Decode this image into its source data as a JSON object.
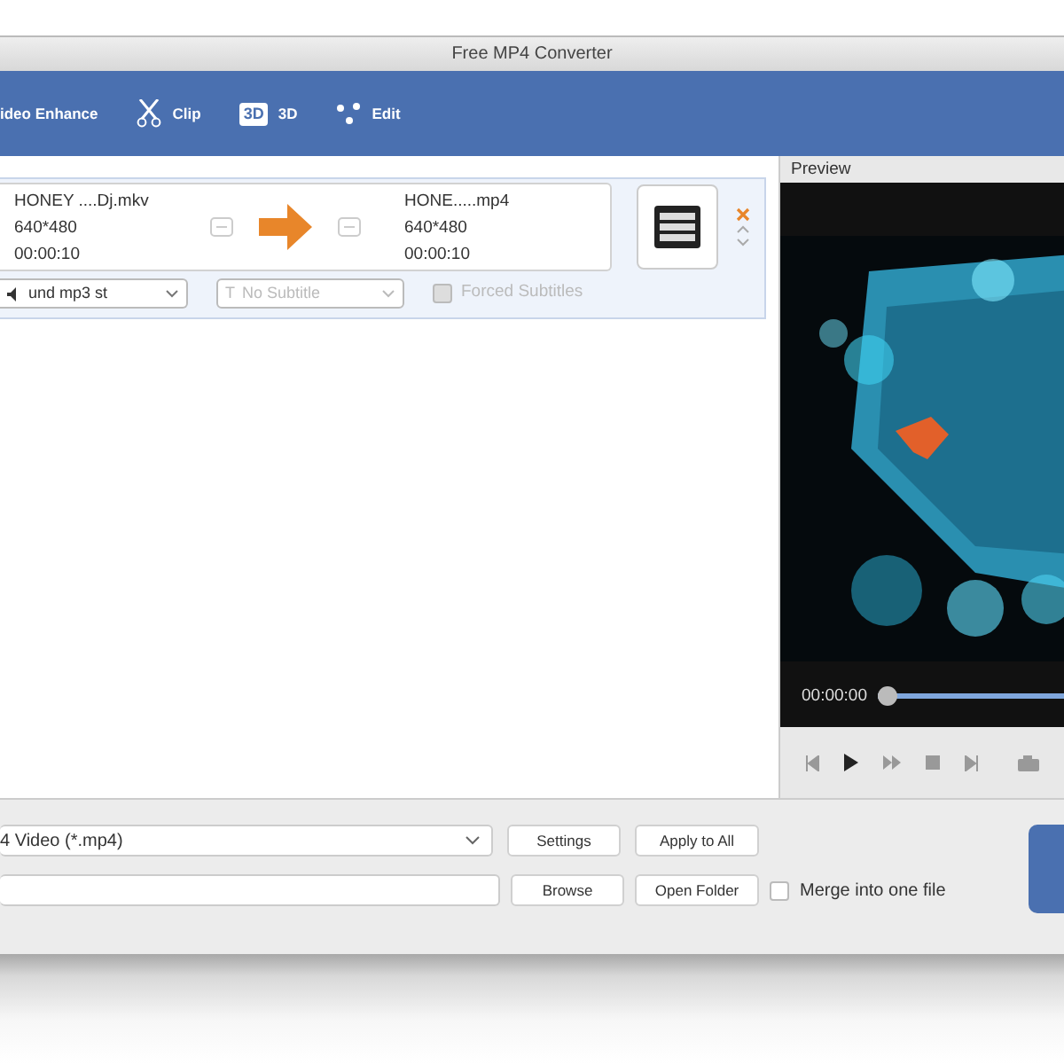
{
  "window": {
    "title": "Free MP4 Converter"
  },
  "toolbar": [
    {
      "kind": "plain",
      "label": "ideo Enhance"
    },
    {
      "kind": "scissors",
      "label": "Clip"
    },
    {
      "kind": "badge",
      "badge": "3D",
      "label": "3D"
    },
    {
      "kind": "dots",
      "label": "Edit"
    }
  ],
  "file": {
    "source": {
      "name": "HONEY ....Dj.mkv",
      "resolution": "640*480",
      "duration": "00:00:10"
    },
    "output": {
      "name": "HONE.....mp4",
      "resolution": "640*480",
      "duration": "00:00:10"
    },
    "audio": {
      "value": "und mp3 st"
    },
    "subtitle": {
      "icon": "T",
      "placeholder": "No Subtitle",
      "disabled": true
    },
    "forced_subtitles": {
      "label": "Forced Subtitles",
      "checked": false,
      "disabled": true
    }
  },
  "preview": {
    "title": "Preview",
    "time": "00:00:00",
    "level": 0
  },
  "bottom": {
    "profile": "4 Video (*.mp4)",
    "buttons": [
      "Settings",
      "Apply to All",
      "Browse",
      "Open Folder"
    ],
    "merge": {
      "label": "Merge into one file",
      "checked": false
    }
  }
}
